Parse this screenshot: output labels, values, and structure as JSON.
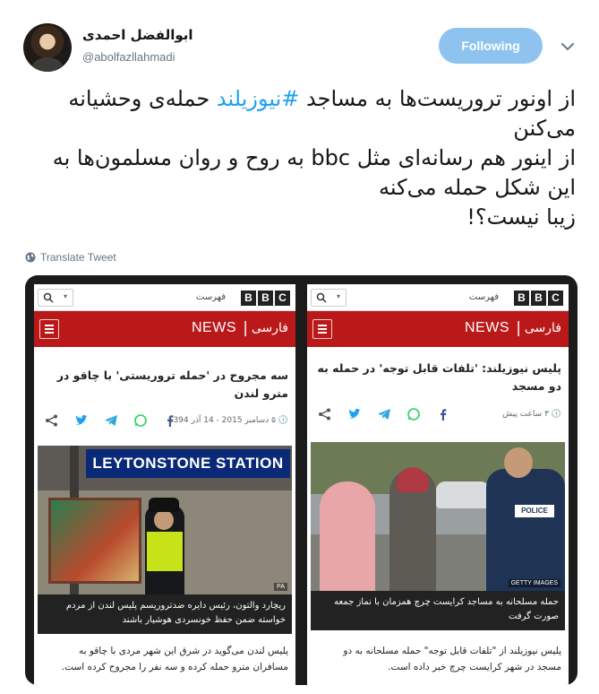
{
  "author": {
    "name": "ابوالفضل احمدی",
    "handle": "@abolfazllahmadi"
  },
  "follow_button": "Following",
  "tweet": {
    "line1_before": "از اونور تروریست‌ها به مساجد ",
    "hashtag": "#نیوزیلند",
    "line1_after": " حمله‌ی وحشیانه",
    "line2": "می‌کنن",
    "line3": "از اینور هم رسانه‌ای مثل bbc به روح و روان مسلمون‌ها به",
    "line4": "این شکل حمله می‌کنه",
    "line5": "زیبا نیست؟!"
  },
  "translate_label": "Translate Tweet",
  "colors": {
    "accent": "#1da1f2",
    "bbc_red": "#bb1919"
  },
  "articles": [
    {
      "menu_label": "فهرست",
      "bbc": [
        "B",
        "B",
        "C"
      ],
      "news": "NEWS",
      "separator": "|",
      "language": "فارسی",
      "headline": "سه مجروح در 'حمله تروریستی' با چاقو در مترو لندن",
      "meta": "۵ دسامبر 2015 - 14 آذر 1394",
      "photo_sign": "LEYTONSTONE STATION",
      "photo_credit": "PA",
      "caption": "ریچارد والتون، رئیس دایره ضدتروریسم پلیس لندن از مردم خواسته ضمن حفظ خونسردی هوشیار باشند",
      "body": "پلیس لندن می‌گوید در شرق این شهر مردی با چاقو به مسافران مترو حمله کرده و سه نفر را مجروح کرده است."
    },
    {
      "menu_label": "فهرست",
      "bbc": [
        "B",
        "B",
        "C"
      ],
      "news": "NEWS",
      "separator": "|",
      "language": "فارسی",
      "headline": "پلیس نیوزیلند: 'تلفات قابل توجه' در حمله به دو مسجد",
      "meta": "۳ ساعت پیش",
      "photo_sign": "POLICE",
      "photo_credit": "GETTY IMAGES",
      "caption": "حمله مسلحانه به مساجد کرایست چرچ همزمان با نماز جمعه صورت گرفت",
      "body": "پلیس نیوزیلند از \"تلفات قابل توجه\" حمله مسلحانه به دو مسجد در شهر کرایست چرچ خبر داده است."
    }
  ]
}
